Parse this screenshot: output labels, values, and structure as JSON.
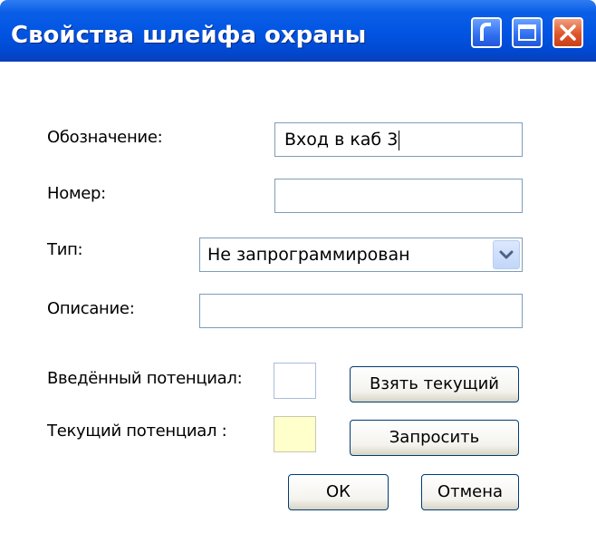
{
  "window": {
    "title": "Свойства шлейфа охраны"
  },
  "titlebar_buttons": {
    "help_icon": "help-icon",
    "maximize_icon": "maximize-icon",
    "close_icon": "close-icon"
  },
  "form": {
    "designation_label": "Обозначение:",
    "designation_value": "Вход в каб 3",
    "number_label": "Номер:",
    "number_value": "",
    "type_label": "Тип:",
    "type_value": "Не запрограммирован",
    "description_label": "Описание:",
    "description_value": "",
    "entered_potential_label": "Введённый потенциал:",
    "current_potential_label": "Текущий потенциал :"
  },
  "buttons": {
    "take_current": "Взять текущий",
    "request": "Запросить",
    "ok": "ОК",
    "cancel": "Отмена"
  },
  "colors": {
    "titlebar": "#0154e2",
    "current_potential_swatch": "#ffffcc",
    "entered_potential_swatch": "#ffffff",
    "close_button": "#e0562a"
  }
}
